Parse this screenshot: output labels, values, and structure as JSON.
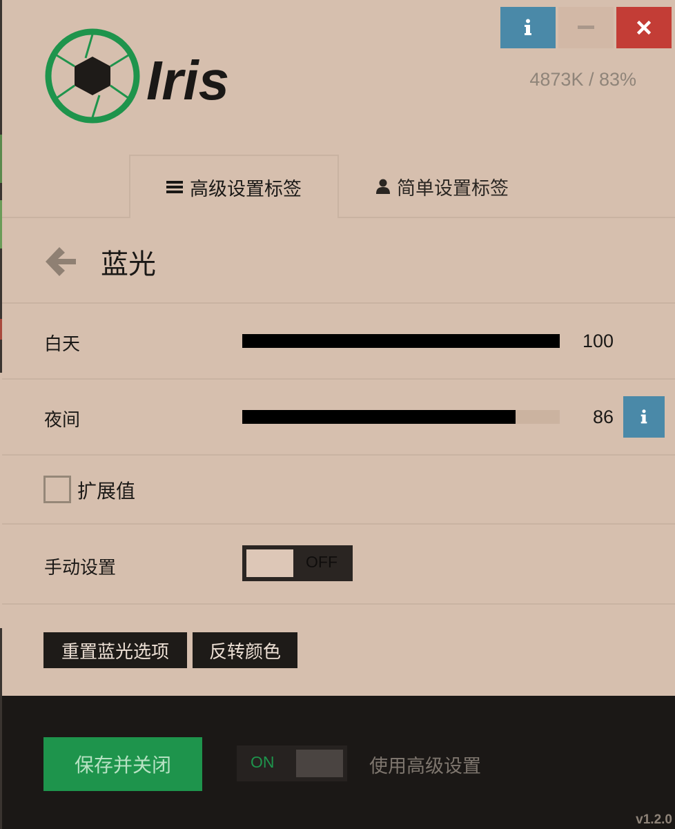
{
  "app": {
    "name": "Iris",
    "brand_color": "#1e944c"
  },
  "stats": {
    "text": "4873K / 83%"
  },
  "window_controls": {
    "info_icon": "info-icon",
    "minimize_icon": "minimize-icon",
    "close_icon": "close-icon"
  },
  "tabs": [
    {
      "label": "高级设置标签",
      "icon": "menu-icon",
      "active": true
    },
    {
      "label": "简单设置标签",
      "icon": "user-icon",
      "active": false
    }
  ],
  "section": {
    "title": "蓝光",
    "back_icon": "arrow-left-icon"
  },
  "sliders": {
    "day": {
      "label": "白天",
      "value": "100",
      "fraction": 1.0
    },
    "night": {
      "label": "夜间",
      "value": "86",
      "fraction": 0.86
    }
  },
  "extended": {
    "label": "扩展值",
    "checked": false
  },
  "manual": {
    "label": "手动设置",
    "state": "OFF"
  },
  "buttons": {
    "reset": "重置蓝光选项",
    "invert": "反转颜色"
  },
  "footer": {
    "save": "保存并关闭",
    "advanced_state": "ON",
    "advanced_label": "使用高级设置",
    "version": "v1.2.0"
  }
}
